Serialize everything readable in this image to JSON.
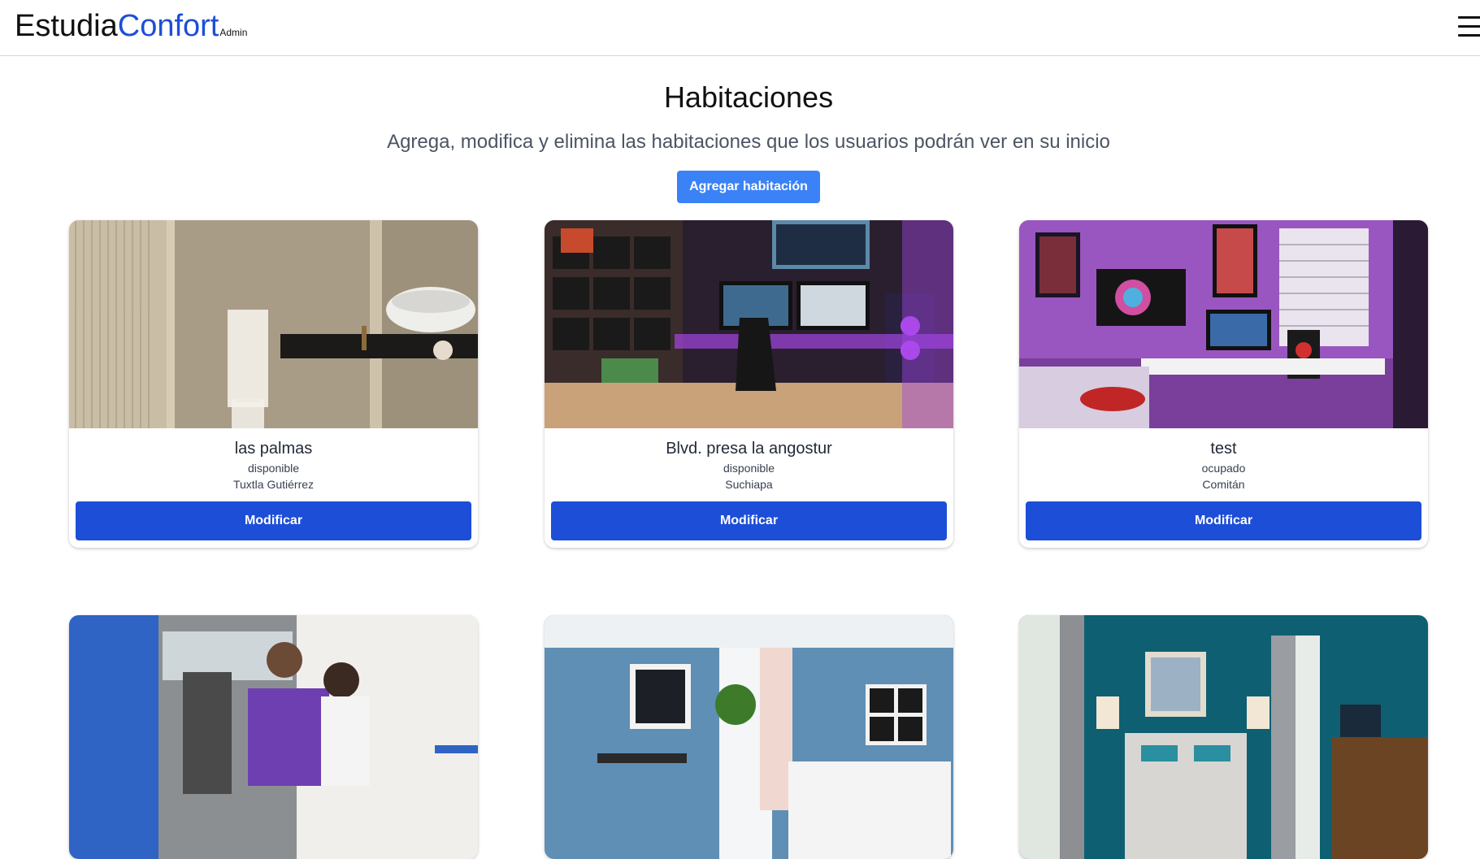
{
  "nav": {
    "brand_part1": "Estudia",
    "brand_part2": "Confort",
    "brand_suffix": "Admin",
    "menu_icon": "hamburger-menu-icon"
  },
  "page": {
    "title": "Habitaciones",
    "subtitle": "Agrega, modifica y elimina las habitaciones que los usuarios podrán ver en su inicio",
    "add_button": "Agregar habitación"
  },
  "rooms": [
    {
      "name": "las palmas",
      "status": "disponible",
      "city": "Tuxtla Gutiérrez",
      "button": "Modificar",
      "image": "bathroom-photo"
    },
    {
      "name": "Blvd. presa la angostur",
      "status": "disponible",
      "city": "Suchiapa",
      "button": "Modificar",
      "image": "gaming-setup-photo"
    },
    {
      "name": "test",
      "status": "ocupado",
      "city": "Comitán",
      "button": "Modificar",
      "image": "purple-bedroom-photo"
    },
    {
      "image": "students-photo"
    },
    {
      "image": "blue-bedroom-photo"
    },
    {
      "image": "teal-bedroom-photo"
    }
  ],
  "colors": {
    "brand_accent": "#1d4ed8",
    "add_button_bg": "#3b82f6",
    "modify_button_bg": "#1d4ed8"
  }
}
